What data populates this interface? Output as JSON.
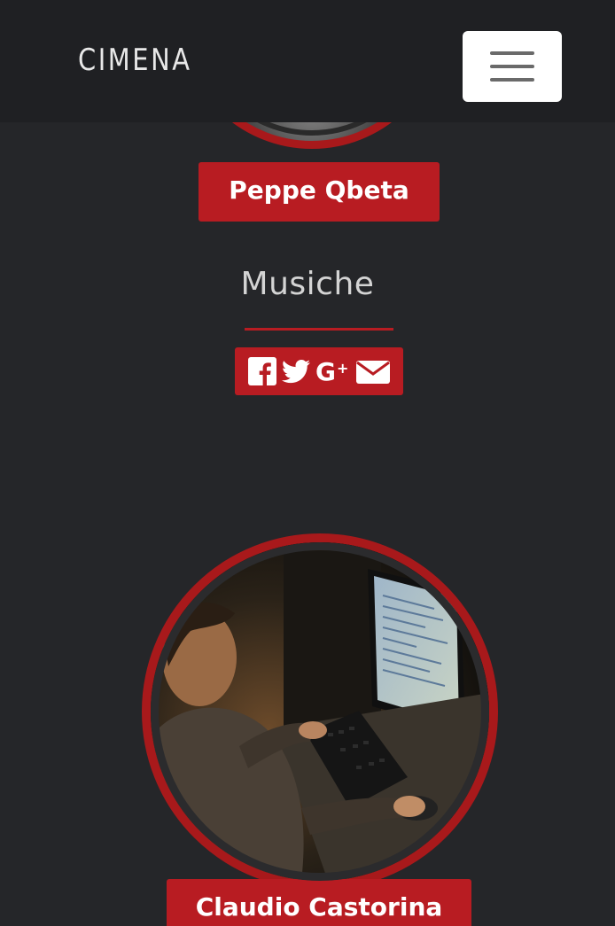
{
  "navbar": {
    "brand": "CIMENA",
    "toggler_icon": "hamburger-menu-icon"
  },
  "members": [
    {
      "name": "Peppe Qbeta",
      "role": "Musiche",
      "social": [
        "facebook-icon",
        "twitter-icon",
        "google-plus-icon",
        "email-icon"
      ]
    },
    {
      "name": "Claudio Castorina"
    }
  ],
  "colors": {
    "background": "#252629",
    "navbar": "#1f2023",
    "accent": "#b81c22",
    "photo_ring": "#a8191b"
  }
}
